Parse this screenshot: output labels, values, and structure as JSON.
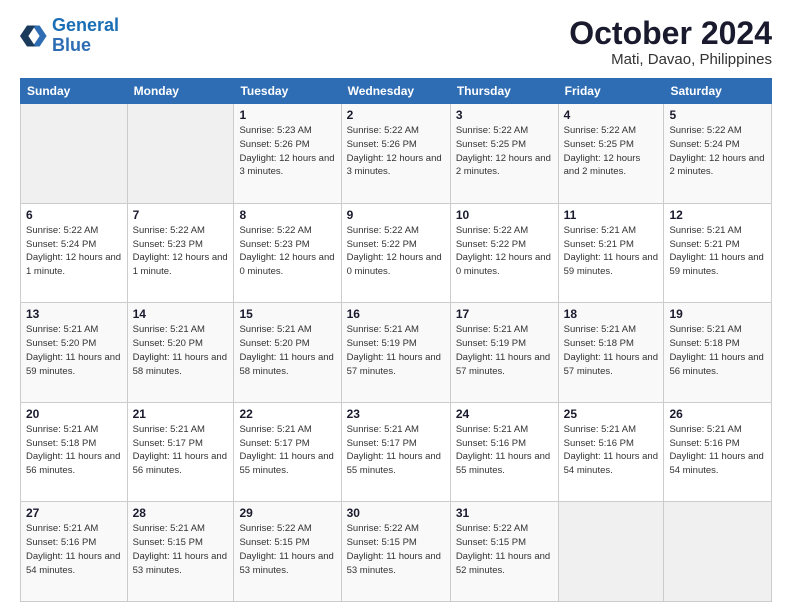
{
  "logo": {
    "line1": "General",
    "line2": "Blue"
  },
  "title": "October 2024",
  "subtitle": "Mati, Davao, Philippines",
  "days_header": [
    "Sunday",
    "Monday",
    "Tuesday",
    "Wednesday",
    "Thursday",
    "Friday",
    "Saturday"
  ],
  "weeks": [
    [
      {
        "day": "",
        "info": ""
      },
      {
        "day": "",
        "info": ""
      },
      {
        "day": "1",
        "info": "Sunrise: 5:23 AM\nSunset: 5:26 PM\nDaylight: 12 hours\nand 3 minutes."
      },
      {
        "day": "2",
        "info": "Sunrise: 5:22 AM\nSunset: 5:26 PM\nDaylight: 12 hours\nand 3 minutes."
      },
      {
        "day": "3",
        "info": "Sunrise: 5:22 AM\nSunset: 5:25 PM\nDaylight: 12 hours\nand 2 minutes."
      },
      {
        "day": "4",
        "info": "Sunrise: 5:22 AM\nSunset: 5:25 PM\nDaylight: 12 hours\nand 2 minutes."
      },
      {
        "day": "5",
        "info": "Sunrise: 5:22 AM\nSunset: 5:24 PM\nDaylight: 12 hours\nand 2 minutes."
      }
    ],
    [
      {
        "day": "6",
        "info": "Sunrise: 5:22 AM\nSunset: 5:24 PM\nDaylight: 12 hours\nand 1 minute."
      },
      {
        "day": "7",
        "info": "Sunrise: 5:22 AM\nSunset: 5:23 PM\nDaylight: 12 hours\nand 1 minute."
      },
      {
        "day": "8",
        "info": "Sunrise: 5:22 AM\nSunset: 5:23 PM\nDaylight: 12 hours\nand 0 minutes."
      },
      {
        "day": "9",
        "info": "Sunrise: 5:22 AM\nSunset: 5:22 PM\nDaylight: 12 hours\nand 0 minutes."
      },
      {
        "day": "10",
        "info": "Sunrise: 5:22 AM\nSunset: 5:22 PM\nDaylight: 12 hours\nand 0 minutes."
      },
      {
        "day": "11",
        "info": "Sunrise: 5:21 AM\nSunset: 5:21 PM\nDaylight: 11 hours\nand 59 minutes."
      },
      {
        "day": "12",
        "info": "Sunrise: 5:21 AM\nSunset: 5:21 PM\nDaylight: 11 hours\nand 59 minutes."
      }
    ],
    [
      {
        "day": "13",
        "info": "Sunrise: 5:21 AM\nSunset: 5:20 PM\nDaylight: 11 hours\nand 59 minutes."
      },
      {
        "day": "14",
        "info": "Sunrise: 5:21 AM\nSunset: 5:20 PM\nDaylight: 11 hours\nand 58 minutes."
      },
      {
        "day": "15",
        "info": "Sunrise: 5:21 AM\nSunset: 5:20 PM\nDaylight: 11 hours\nand 58 minutes."
      },
      {
        "day": "16",
        "info": "Sunrise: 5:21 AM\nSunset: 5:19 PM\nDaylight: 11 hours\nand 57 minutes."
      },
      {
        "day": "17",
        "info": "Sunrise: 5:21 AM\nSunset: 5:19 PM\nDaylight: 11 hours\nand 57 minutes."
      },
      {
        "day": "18",
        "info": "Sunrise: 5:21 AM\nSunset: 5:18 PM\nDaylight: 11 hours\nand 57 minutes."
      },
      {
        "day": "19",
        "info": "Sunrise: 5:21 AM\nSunset: 5:18 PM\nDaylight: 11 hours\nand 56 minutes."
      }
    ],
    [
      {
        "day": "20",
        "info": "Sunrise: 5:21 AM\nSunset: 5:18 PM\nDaylight: 11 hours\nand 56 minutes."
      },
      {
        "day": "21",
        "info": "Sunrise: 5:21 AM\nSunset: 5:17 PM\nDaylight: 11 hours\nand 56 minutes."
      },
      {
        "day": "22",
        "info": "Sunrise: 5:21 AM\nSunset: 5:17 PM\nDaylight: 11 hours\nand 55 minutes."
      },
      {
        "day": "23",
        "info": "Sunrise: 5:21 AM\nSunset: 5:17 PM\nDaylight: 11 hours\nand 55 minutes."
      },
      {
        "day": "24",
        "info": "Sunrise: 5:21 AM\nSunset: 5:16 PM\nDaylight: 11 hours\nand 55 minutes."
      },
      {
        "day": "25",
        "info": "Sunrise: 5:21 AM\nSunset: 5:16 PM\nDaylight: 11 hours\nand 54 minutes."
      },
      {
        "day": "26",
        "info": "Sunrise: 5:21 AM\nSunset: 5:16 PM\nDaylight: 11 hours\nand 54 minutes."
      }
    ],
    [
      {
        "day": "27",
        "info": "Sunrise: 5:21 AM\nSunset: 5:16 PM\nDaylight: 11 hours\nand 54 minutes."
      },
      {
        "day": "28",
        "info": "Sunrise: 5:21 AM\nSunset: 5:15 PM\nDaylight: 11 hours\nand 53 minutes."
      },
      {
        "day": "29",
        "info": "Sunrise: 5:22 AM\nSunset: 5:15 PM\nDaylight: 11 hours\nand 53 minutes."
      },
      {
        "day": "30",
        "info": "Sunrise: 5:22 AM\nSunset: 5:15 PM\nDaylight: 11 hours\nand 53 minutes."
      },
      {
        "day": "31",
        "info": "Sunrise: 5:22 AM\nSunset: 5:15 PM\nDaylight: 11 hours\nand 52 minutes."
      },
      {
        "day": "",
        "info": ""
      },
      {
        "day": "",
        "info": ""
      }
    ]
  ]
}
